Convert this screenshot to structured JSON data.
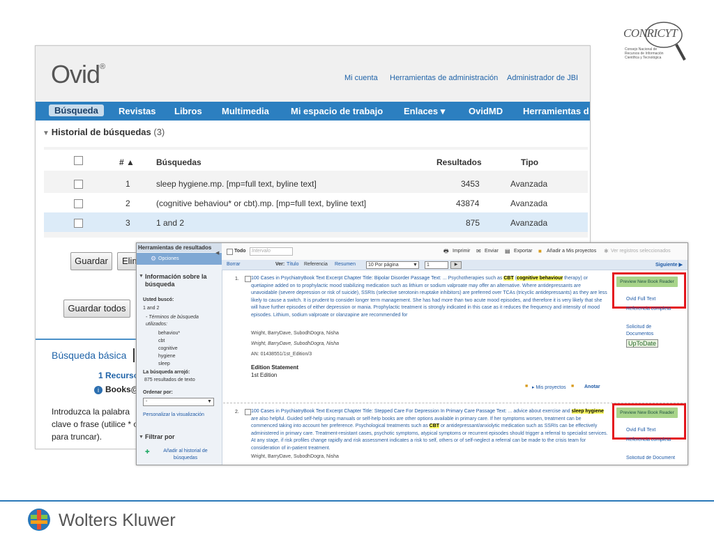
{
  "ovid": {
    "logo": "Ovid",
    "reg": "®",
    "toplinks": [
      "Mi cuenta",
      "Herramientas de administración",
      "Administrador de JBI"
    ],
    "nav": [
      "Búsqueda",
      "Revistas",
      "Libros",
      "Multimedia",
      "Mi espacio de trabajo",
      "Enlaces ▾",
      "OvidMD",
      "Herramientas d"
    ],
    "history_title": "Historial de búsquedas",
    "history_count": "(3)",
    "table": {
      "headers": {
        "num": "# ▲",
        "searches": "Búsquedas",
        "results": "Resultados",
        "type": "Tipo"
      },
      "rows": [
        {
          "num": "1",
          "query": "sleep hygiene.mp. [mp=full text, byline text]",
          "results": "3453",
          "type": "Avanzada"
        },
        {
          "num": "2",
          "query": "(cognitive behaviou* or cbt).mp. [mp=full text, byline text]",
          "results": "43874",
          "type": "Avanzada"
        },
        {
          "num": "3",
          "query": "1 and 2",
          "results": "875",
          "type": "Avanzada"
        }
      ]
    },
    "buttons": {
      "guardar": "Guardar",
      "eliminar": "Elim",
      "guardar_todos": "Guardar todos"
    },
    "basic": {
      "title": "Búsqueda básica",
      "recurso": "1 Recurso s",
      "books": "Books@",
      "intro": [
        "Introduzca la palabra",
        "clave o frase (utilice * o",
        "para truncar)."
      ]
    }
  },
  "overlay": {
    "left": {
      "tools_title": "Herramientas de resultados",
      "options": "Opciones",
      "info_title": "Información sobre la búsqueda",
      "usted_busco": "Usted buscó:",
      "query": "1 and 2",
      "terms_label": "- Términos de búsqueda utilizados:",
      "terms": [
        "behaviou*",
        "cbt",
        "cognitive",
        "hygiene",
        "sleep"
      ],
      "returned": "La búsqueda arrojó:",
      "returned_count": "875 resultados de texto",
      "sort_label": "Ordenar por:",
      "sort_value": "-",
      "personalize": "Personalizar la visualización",
      "filter_title": "Filtrar por",
      "add_history": "Añadir al historial de búsquedas"
    },
    "toolbar": {
      "all": "Todo",
      "range_placeholder": "Intervalo",
      "print": "Imprimir",
      "send": "Enviar",
      "export": "Exportar",
      "add_projects": "Añadir a Mis proyectos",
      "view_selected": "Ver registros seleccionados",
      "clear": "Borrar",
      "view_label": "Ver:",
      "view_options": [
        "Título",
        "Referencia",
        "Resumen"
      ],
      "per_page": "10 Por página",
      "page": "1",
      "next": "Siguiente ▶"
    },
    "results": [
      {
        "num": "1.",
        "title": "100 Cases in PsychiatryBook Text Excerpt Chapter Title: Bipolar Disorder Passage Text:",
        "authors1": "Wright, BarryDave, SubodhDogra, Nisha",
        "authors2": "Wright, BarryDave, SubodhDogra, Nisha",
        "an": "AN: 01438551/1st_Edition/3",
        "edition_label": "Edition Statement",
        "edition": "1st Edition",
        "projects": "Mis proyectos",
        "annotate": "Anotar"
      },
      {
        "num": "2.",
        "title": "100 Cases in PsychiatryBook Text Excerpt Chapter Title: Stepped Care For Depression In Primary Care Passage Text:",
        "authors1": "Wright, BarryDave, SubodhDogra, Nisha"
      }
    ],
    "sidebar": {
      "preview": "Preview New Book Reader",
      "full_text": "Ovid Full Text",
      "ref_complete": "Referencia completa",
      "solicitud": "Solicitud de Documentos",
      "uptodate": "UpToDate"
    }
  },
  "brand": {
    "conricyt": "CONRICYT",
    "conricyt_sub": [
      "Consejo Nacional de",
      "Recursos de Información",
      "Científica y Tecnológica"
    ],
    "wk": "Wolters Kluwer"
  },
  "colors": {
    "nav_blue": "#2c7fc0",
    "highlight": "#ffff66",
    "red_box": "#e4181e",
    "wk_blue": "#2a78b8"
  }
}
